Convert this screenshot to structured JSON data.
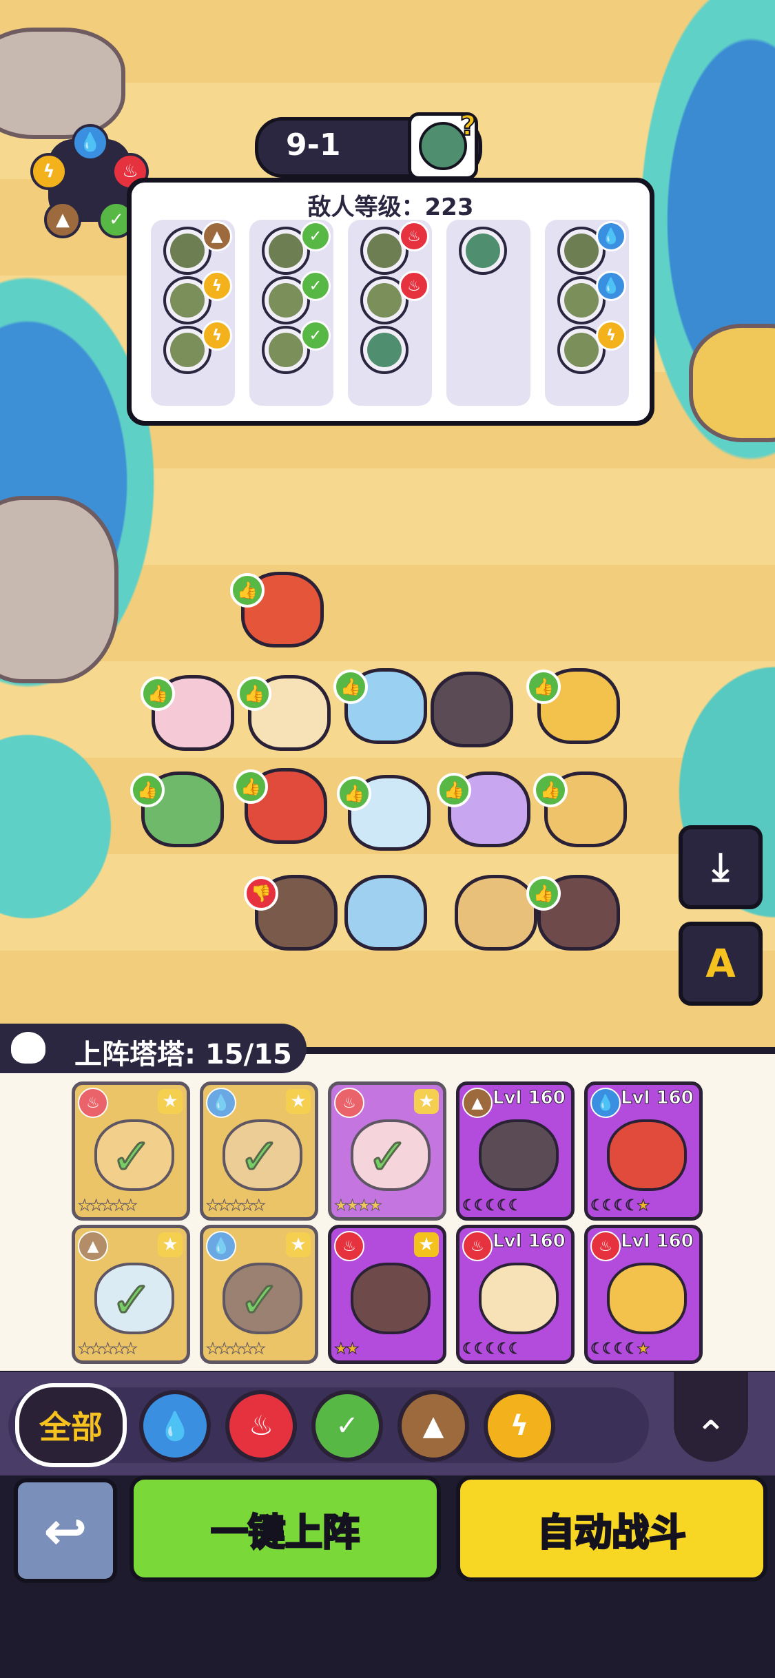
{
  "stage": {
    "label": "9-1",
    "unknown_mark": "?"
  },
  "enemy_panel": {
    "title": "敌人等级：223",
    "columns": [
      {
        "element": "earth",
        "enemies": [
          {
            "type": "earth"
          },
          {
            "type": "lightning"
          },
          {
            "type": "lightning"
          }
        ]
      },
      {
        "element": "grass",
        "enemies": [
          {
            "type": "grass"
          },
          {
            "type": "grass"
          },
          {
            "type": "grass"
          }
        ]
      },
      {
        "element": "fire",
        "enemies": [
          {
            "type": "fire"
          },
          {
            "type": "fire"
          },
          {
            "type": "none"
          }
        ]
      },
      {
        "element": "none",
        "enemies": [
          {
            "type": "none"
          }
        ]
      },
      {
        "element": "water",
        "enemies": [
          {
            "type": "water"
          },
          {
            "type": "water"
          },
          {
            "type": "lightning"
          }
        ]
      }
    ]
  },
  "element_wheel": {
    "icons": [
      "water-icon",
      "fire-icon",
      "grass-icon",
      "earth-icon",
      "lightning-icon"
    ]
  },
  "field": {
    "thumb_icon": "👍",
    "dislike_icon": "👎"
  },
  "side_buttons": {
    "download_icon": "⤓",
    "auto_settings_label": "A"
  },
  "roster": {
    "title": "上阵塔塔: 15/15",
    "cards_top": [
      {
        "style": "gold",
        "type": "fire",
        "selected": true,
        "level": "",
        "stars": "★★★★★"
      },
      {
        "style": "gold",
        "type": "water",
        "selected": true,
        "level": "",
        "stars": "★★★★★"
      },
      {
        "style": "purple",
        "type": "fire",
        "selected": true,
        "level": "",
        "stars": "★★★★"
      },
      {
        "style": "purple",
        "type": "earth",
        "selected": false,
        "level": "Lvl 160",
        "stars": "☾☾☾☾☾"
      },
      {
        "style": "purple",
        "type": "water",
        "selected": false,
        "level": "Lvl 160",
        "stars": "☾☾☾☾★"
      }
    ],
    "cards_bottom": [
      {
        "style": "gold",
        "type": "earth",
        "selected": true,
        "level": "",
        "stars": "★★★★★"
      },
      {
        "style": "gold",
        "type": "water",
        "selected": true,
        "level": "",
        "stars": "★★★★★"
      },
      {
        "style": "purple",
        "type": "fire",
        "selected": false,
        "level": "",
        "stars": "★★"
      },
      {
        "style": "purple",
        "type": "fire",
        "selected": false,
        "level": "Lvl 160",
        "stars": "☾☾☾☾☾"
      },
      {
        "style": "purple",
        "type": "fire",
        "selected": false,
        "level": "Lvl 160",
        "stars": "☾☾☾☾★"
      }
    ]
  },
  "filters": {
    "all_label": "全部",
    "elements": [
      "water",
      "fire",
      "grass",
      "earth",
      "lightning"
    ],
    "collapse_icon": "⌃"
  },
  "actions": {
    "back_icon": "↩",
    "one_click_label": "一键上阵",
    "auto_battle_label": "自动战斗"
  },
  "colors": {
    "water": "#3a8fe0",
    "fire": "#e6323f",
    "grass": "#58b845",
    "earth": "#9c6a3c",
    "lightning": "#f3b21c",
    "none": "#8a9a8f"
  }
}
